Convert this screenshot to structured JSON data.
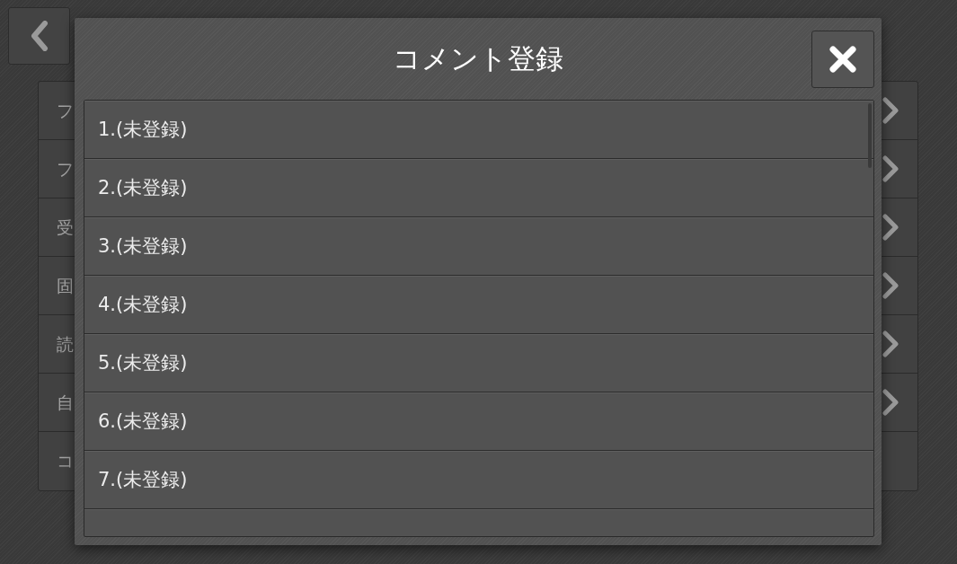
{
  "back_list": [
    {
      "label": "フ",
      "has_chevron": true
    },
    {
      "label": "フ",
      "has_chevron": true
    },
    {
      "label": "受",
      "has_chevron": true
    },
    {
      "label": "固",
      "has_chevron": true
    },
    {
      "label": "読",
      "has_chevron": true
    },
    {
      "label": "自",
      "has_chevron": true
    },
    {
      "label": "コ",
      "has_chevron": false
    }
  ],
  "dialog": {
    "title": "コメント登録",
    "items": [
      {
        "label": "1.(未登録)"
      },
      {
        "label": "2.(未登録)"
      },
      {
        "label": "3.(未登録)"
      },
      {
        "label": "4.(未登録)"
      },
      {
        "label": "5.(未登録)"
      },
      {
        "label": "6.(未登録)"
      },
      {
        "label": "7.(未登録)"
      }
    ]
  }
}
